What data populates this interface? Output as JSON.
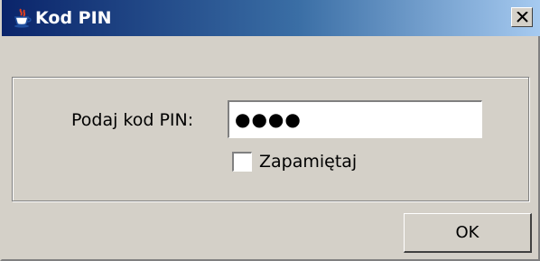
{
  "window": {
    "title": "Kod PIN",
    "icon": "java-cup-icon",
    "close_icon": "close-icon"
  },
  "form": {
    "pin_label": "Podaj kod PIN:",
    "pin_value": "●●●●",
    "remember_label": "Zapamiętaj",
    "remember_checked": false
  },
  "buttons": {
    "ok_label": "OK"
  }
}
